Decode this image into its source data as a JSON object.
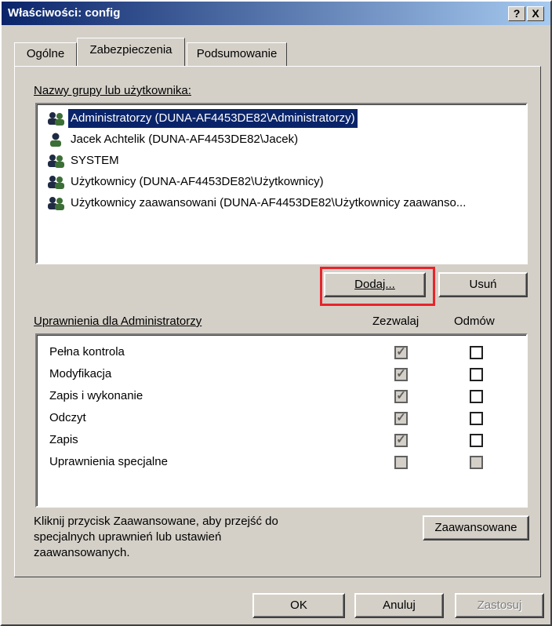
{
  "window": {
    "title": "Właściwości: config",
    "help_label": "?",
    "close_label": "X"
  },
  "tabs": [
    {
      "label": "Ogólne",
      "active": false
    },
    {
      "label": "Zabezpieczenia",
      "active": true
    },
    {
      "label": "Podsumowanie",
      "active": false
    }
  ],
  "users": {
    "label": "Nazwy grupy lub użytkownika:",
    "items": [
      {
        "name": "Administratorzy (DUNA-AF4453DE82\\Administratorzy)",
        "icon": "group-icon",
        "selected": true
      },
      {
        "name": "Jacek Achtelik (DUNA-AF4453DE82\\Jacek)",
        "icon": "user-icon",
        "selected": false
      },
      {
        "name": "SYSTEM",
        "icon": "group-icon",
        "selected": false
      },
      {
        "name": "Użytkownicy (DUNA-AF4453DE82\\Użytkownicy)",
        "icon": "group-icon",
        "selected": false
      },
      {
        "name": "Użytkownicy zaawansowani (DUNA-AF4453DE82\\Użytkownicy zaawanso...",
        "icon": "group-icon",
        "selected": false
      }
    ]
  },
  "buttons": {
    "add": "Dodaj...",
    "remove": "Usuń",
    "advanced": "Zaawansowane",
    "ok": "OK",
    "cancel": "Anuluj",
    "apply": "Zastosuj"
  },
  "permissions": {
    "label": "Uprawnienia dla Administratorzy",
    "allow_header": "Zezwalaj",
    "deny_header": "Odmów",
    "rows": [
      {
        "name": "Pełna kontrola",
        "allow": true,
        "deny": false,
        "allow_disabled": true,
        "deny_disabled": false
      },
      {
        "name": "Modyfikacja",
        "allow": true,
        "deny": false,
        "allow_disabled": true,
        "deny_disabled": false
      },
      {
        "name": "Zapis i wykonanie",
        "allow": true,
        "deny": false,
        "allow_disabled": true,
        "deny_disabled": false
      },
      {
        "name": "Odczyt",
        "allow": true,
        "deny": false,
        "allow_disabled": true,
        "deny_disabled": false
      },
      {
        "name": "Zapis",
        "allow": true,
        "deny": false,
        "allow_disabled": true,
        "deny_disabled": false
      },
      {
        "name": "Uprawnienia specjalne",
        "allow": false,
        "deny": false,
        "allow_disabled": true,
        "deny_disabled": true
      }
    ]
  },
  "info_text_lines": [
    "Kliknij przycisk Zaawansowane, aby przejść do",
    "specjalnych uprawnień lub ustawień",
    "zaawansowanych."
  ],
  "colors": {
    "title_bar": "#0a246a",
    "highlight_box": "#e8242a",
    "dialog_bg": "#d4d0c8"
  }
}
